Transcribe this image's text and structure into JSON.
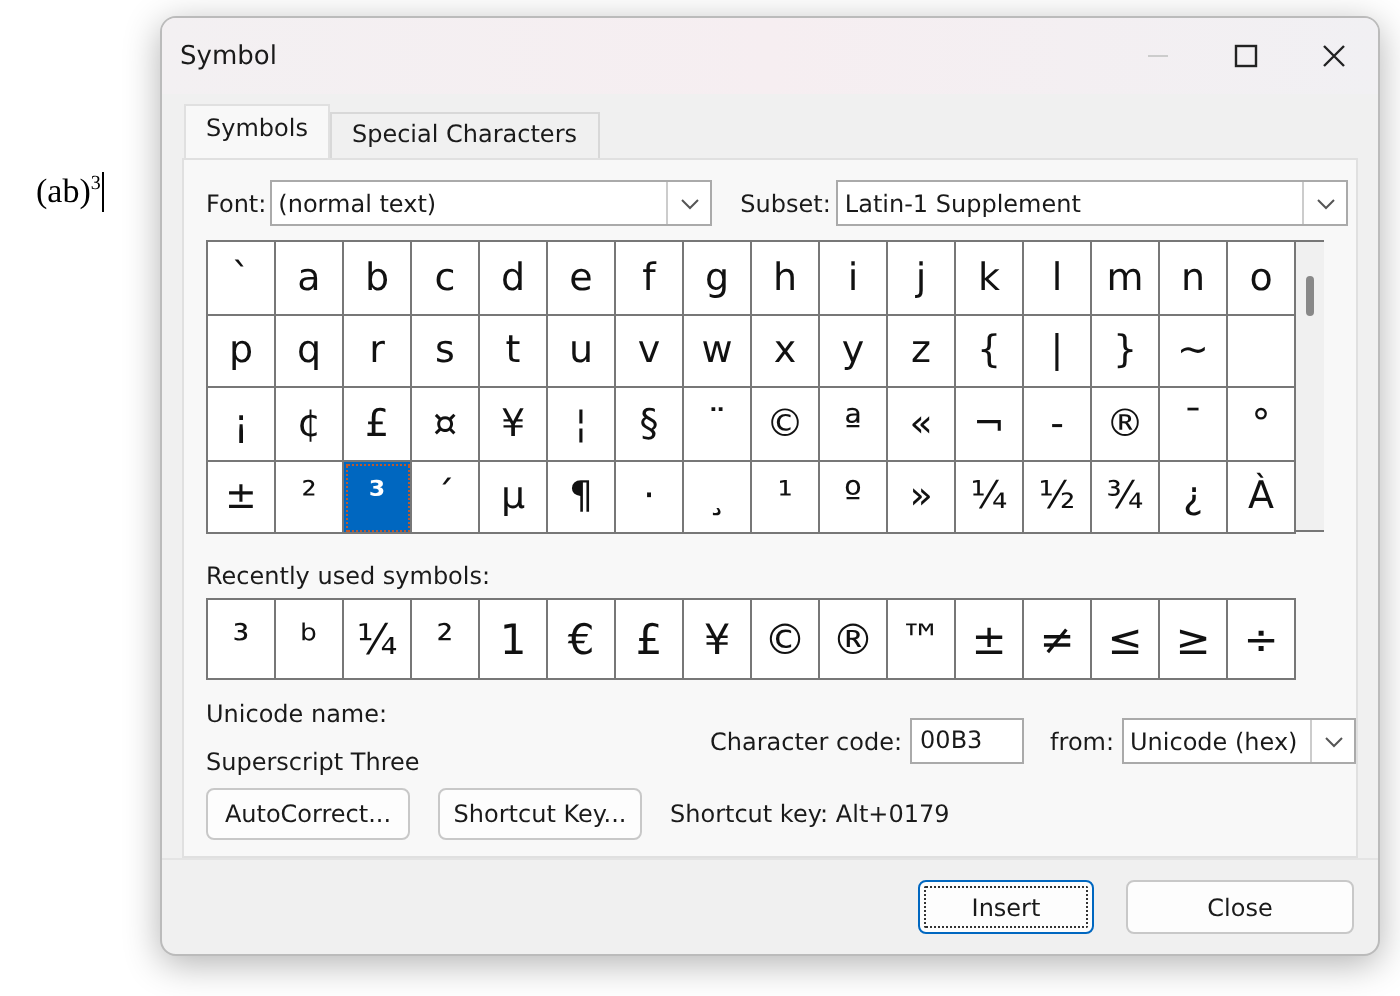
{
  "document": {
    "text": "(ab)$^{3}$"
  },
  "dialog": {
    "title": "Symbol",
    "tabs": [
      {
        "label": "Symbols",
        "selected": true
      },
      {
        "label": "Special Characters",
        "selected": false
      }
    ],
    "font": {
      "label": "Font:",
      "value": "(normal text)"
    },
    "subset": {
      "label": "Subset:",
      "value": "Latin-1 Supplement"
    },
    "grid": [
      [
        {
          "char": "`",
          "selected": false
        },
        {
          "char": "a",
          "selected": false
        },
        {
          "char": "b",
          "selected": false
        },
        {
          "char": "c",
          "selected": false
        },
        {
          "char": "d",
          "selected": false
        },
        {
          "char": "e",
          "selected": false
        },
        {
          "char": "f",
          "selected": false
        },
        {
          "char": "g",
          "selected": false
        },
        {
          "char": "h",
          "selected": false
        },
        {
          "char": "i",
          "selected": false
        },
        {
          "char": "j",
          "selected": false
        },
        {
          "char": "k",
          "selected": false
        },
        {
          "char": "l",
          "selected": false
        },
        {
          "char": "m",
          "selected": false
        },
        {
          "char": "n",
          "selected": false
        },
        {
          "char": "o",
          "selected": false
        }
      ],
      [
        {
          "char": "p",
          "selected": false
        },
        {
          "char": "q",
          "selected": false
        },
        {
          "char": "r",
          "selected": false
        },
        {
          "char": "s",
          "selected": false
        },
        {
          "char": "t",
          "selected": false
        },
        {
          "char": "u",
          "selected": false
        },
        {
          "char": "v",
          "selected": false
        },
        {
          "char": "w",
          "selected": false
        },
        {
          "char": "x",
          "selected": false
        },
        {
          "char": "y",
          "selected": false
        },
        {
          "char": "z",
          "selected": false
        },
        {
          "char": "{",
          "selected": false
        },
        {
          "char": "|",
          "selected": false
        },
        {
          "char": "}",
          "selected": false
        },
        {
          "char": "~",
          "selected": false
        }
      ],
      [
        {
          "char": "¡",
          "selected": false
        },
        {
          "char": "¢",
          "selected": false
        },
        {
          "char": "£",
          "selected": false
        },
        {
          "char": "¤",
          "selected": false
        },
        {
          "char": "¥",
          "selected": false
        },
        {
          "char": "¦",
          "selected": false
        },
        {
          "char": "§",
          "selected": false
        },
        {
          "char": "¨",
          "selected": false
        },
        {
          "char": "©",
          "selected": false
        },
        {
          "char": "ª",
          "selected": false
        },
        {
          "char": "«",
          "selected": false
        },
        {
          "char": "¬",
          "selected": false
        },
        {
          "char": "-",
          "selected": false
        },
        {
          "char": "®",
          "selected": false
        },
        {
          "char": "¯",
          "selected": false
        },
        {
          "char": "°",
          "selected": false
        }
      ],
      [
        {
          "char": "±",
          "selected": false
        },
        {
          "char": "²",
          "selected": false
        },
        {
          "char": "³",
          "selected": true
        },
        {
          "char": "´",
          "selected": false
        },
        {
          "char": "µ",
          "selected": false
        },
        {
          "char": "¶",
          "selected": false
        },
        {
          "char": "·",
          "selected": false
        },
        {
          "char": "¸",
          "selected": false
        },
        {
          "char": "¹",
          "selected": false
        },
        {
          "char": "º",
          "selected": false
        },
        {
          "char": "»",
          "selected": false
        },
        {
          "char": "¼",
          "selected": false
        },
        {
          "char": "½",
          "selected": false
        },
        {
          "char": "¾",
          "selected": false
        },
        {
          "char": "¿",
          "selected": false
        },
        {
          "char": "À",
          "selected": false
        }
      ]
    ],
    "recent": {
      "label": "Recently used symbols:",
      "symbols": [
        "³",
        "ᵇ",
        "¼",
        "²",
        "1",
        "€",
        "£",
        "¥",
        "©",
        "®",
        "™",
        "±",
        "≠",
        "≤",
        "≥",
        "÷"
      ]
    },
    "unicode_name": {
      "label": "Unicode name:",
      "value": "Superscript Three"
    },
    "character_code": {
      "label": "Character code:",
      "value": "00B3"
    },
    "from": {
      "label": "from:",
      "value": "Unicode (hex)"
    },
    "buttons": [
      "AutoCorrect...",
      "Shortcut Key..."
    ],
    "shortcut_key": "Shortcut key: Alt+0179",
    "footer_buttons": [
      {
        "label": "Insert",
        "default": true
      },
      {
        "label": "Close",
        "default": false
      }
    ]
  }
}
